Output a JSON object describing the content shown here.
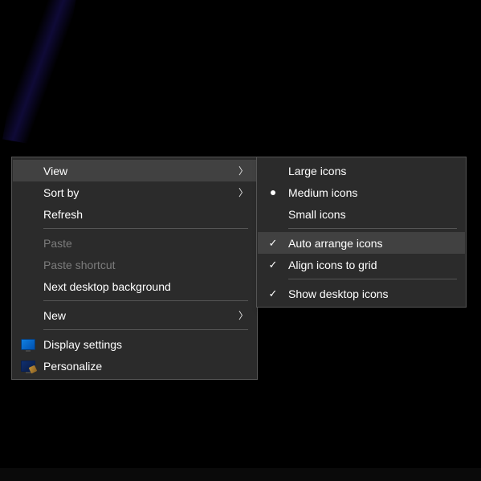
{
  "primaryMenu": {
    "view": "View",
    "sortBy": "Sort by",
    "refresh": "Refresh",
    "paste": "Paste",
    "pasteShortcut": "Paste shortcut",
    "nextDesktopBackground": "Next desktop background",
    "new": "New",
    "displaySettings": "Display settings",
    "personalize": "Personalize"
  },
  "viewSubmenu": {
    "largeIcons": "Large icons",
    "mediumIcons": "Medium icons",
    "smallIcons": "Small icons",
    "autoArrange": "Auto arrange icons",
    "alignToGrid": "Align icons to grid",
    "showDesktopIcons": "Show desktop icons"
  },
  "state": {
    "iconSize": "medium",
    "autoArrange": true,
    "alignToGrid": true,
    "showDesktopIcons": true,
    "highlightedPrimary": "view",
    "highlightedSub": "autoArrange"
  }
}
